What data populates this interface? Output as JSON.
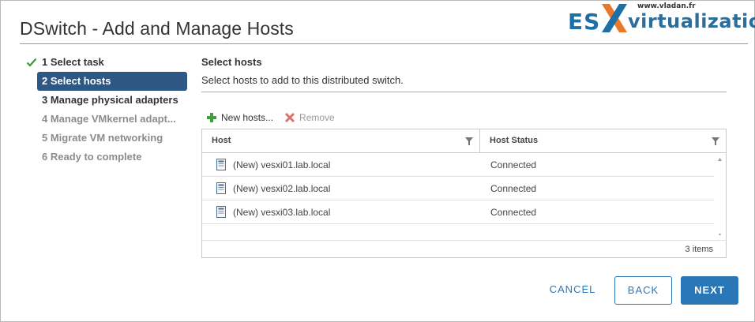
{
  "dialog": {
    "title": "DSwitch - Add and Manage Hosts"
  },
  "watermark": {
    "site": "www.vladan.fr",
    "brand_left": "ES",
    "brand_right": "virtualization",
    "colors": {
      "blue": "#1f6fa7",
      "orange": "#e8792b"
    }
  },
  "steps": [
    {
      "label": "1 Select task",
      "state": "done",
      "icon": "check-icon"
    },
    {
      "label": "2 Select hosts",
      "state": "active"
    },
    {
      "label": "3 Manage physical adapters",
      "state": "todo"
    },
    {
      "label": "4 Manage VMkernel adapt...",
      "state": "disabled"
    },
    {
      "label": "5 Migrate VM networking",
      "state": "disabled"
    },
    {
      "label": "6 Ready to complete",
      "state": "disabled"
    }
  ],
  "content": {
    "title": "Select hosts",
    "description": "Select hosts to add to this distributed switch."
  },
  "toolbar": {
    "new_hosts": "New hosts...",
    "remove": "Remove"
  },
  "grid": {
    "columns": [
      "Host",
      "Host Status"
    ],
    "rows": [
      {
        "host": "(New) vesxi01.lab.local",
        "status": "Connected"
      },
      {
        "host": "(New) vesxi02.lab.local",
        "status": "Connected"
      },
      {
        "host": "(New) vesxi03.lab.local",
        "status": "Connected"
      }
    ],
    "footer": "3 items"
  },
  "buttons": {
    "cancel": "CANCEL",
    "back": "BACK",
    "next": "NEXT"
  },
  "colors": {
    "accent": "#2a77b8",
    "active_step": "#2d5785",
    "check": "#3c9a3c",
    "add_icon": "#3ca03c",
    "remove_icon": "#e07070"
  }
}
